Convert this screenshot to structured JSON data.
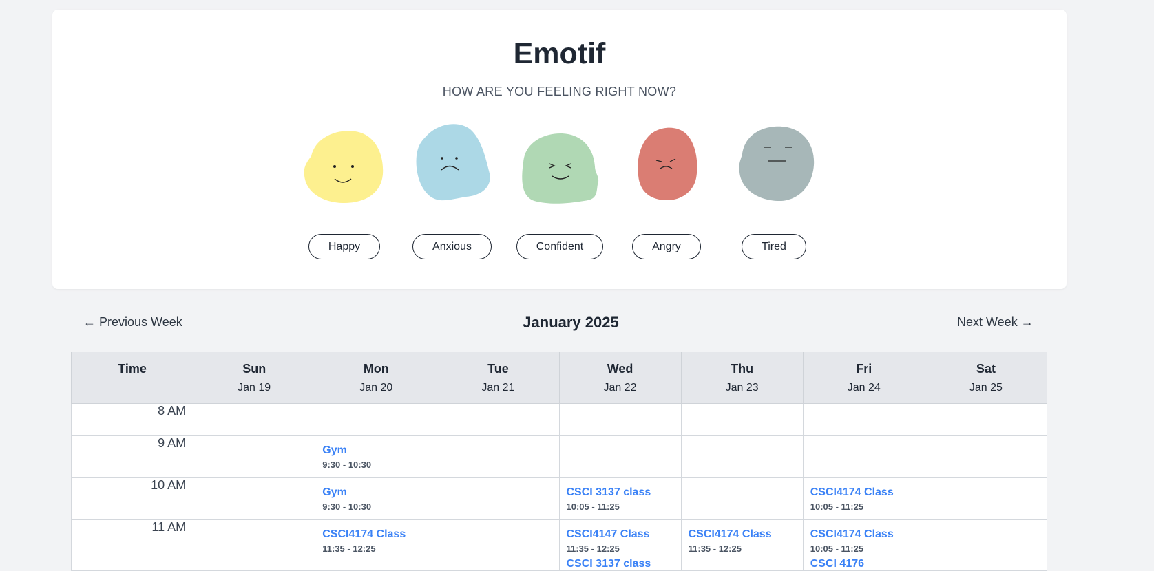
{
  "app": {
    "title": "Emotif",
    "prompt": "HOW ARE YOU FEELING RIGHT NOW?"
  },
  "moods": [
    {
      "label": "Happy",
      "color": "#fdf08f"
    },
    {
      "label": "Anxious",
      "color": "#acd8e6"
    },
    {
      "label": "Confident",
      "color": "#b0d8b4"
    },
    {
      "label": "Angry",
      "color": "#da7d73"
    },
    {
      "label": "Tired",
      "color": "#a7b7b8"
    }
  ],
  "calendar": {
    "prev_label": "← Previous Week",
    "next_label": "Next Week →",
    "month": "January 2025",
    "time_header": "Time",
    "days": [
      {
        "name": "Sun",
        "date": "Jan 19"
      },
      {
        "name": "Mon",
        "date": "Jan 20"
      },
      {
        "name": "Tue",
        "date": "Jan 21"
      },
      {
        "name": "Wed",
        "date": "Jan 22"
      },
      {
        "name": "Thu",
        "date": "Jan 23"
      },
      {
        "name": "Fri",
        "date": "Jan 24"
      },
      {
        "name": "Sat",
        "date": "Jan 25"
      }
    ],
    "rows": [
      {
        "time": "8 AM"
      },
      {
        "time": "9 AM",
        "mon": {
          "title": "Gym",
          "time": "9:30 - 10:30"
        }
      },
      {
        "time": "10 AM",
        "mon": {
          "title": "Gym",
          "time": "9:30 - 10:30"
        },
        "wed": {
          "title": "CSCI 3137 class",
          "time": "10:05 - 11:25"
        },
        "fri": {
          "title": "CSCI4174 Class",
          "time": "10:05 - 11:25"
        }
      },
      {
        "time": "11 AM",
        "mon": {
          "title": "CSCI4174 Class",
          "time": "11:35 - 12:25"
        },
        "wed": {
          "title": "CSCI4147 Class",
          "time": "11:35 - 12:25"
        },
        "wed2": {
          "title": "CSCI 3137 class"
        },
        "thu": {
          "title": "CSCI4174 Class",
          "time": "11:35 - 12:25"
        },
        "fri": {
          "title": "CSCI4174 Class",
          "time": "10:05 - 11:25"
        },
        "fri2": {
          "title": "CSCI 4176"
        }
      }
    ],
    "accent_color": "#3b82f6"
  }
}
